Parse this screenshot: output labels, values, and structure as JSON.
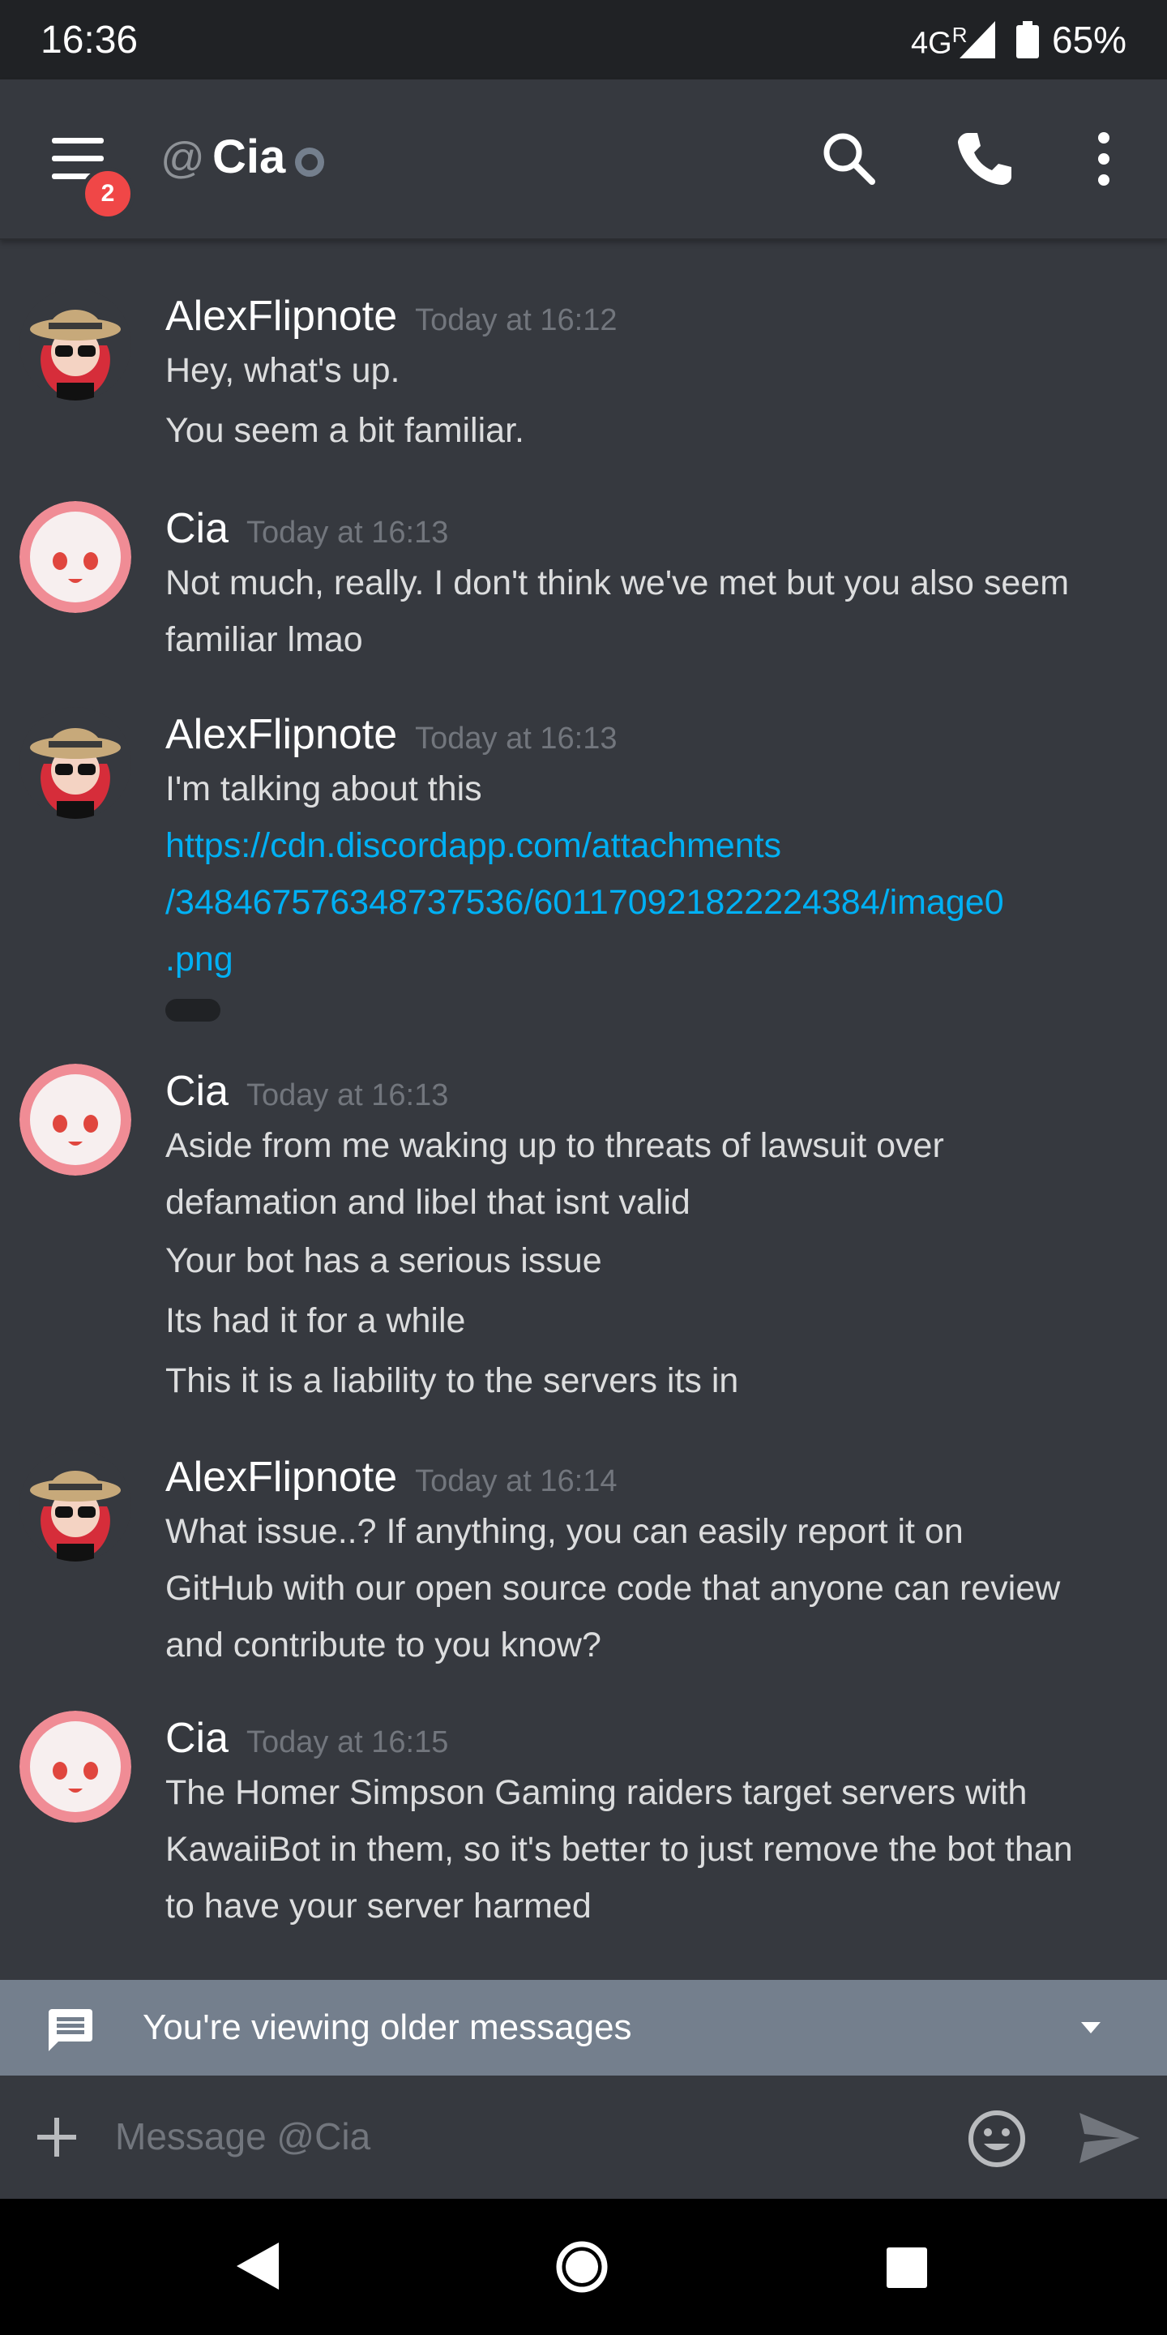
{
  "status_bar": {
    "time": "16:36",
    "network": "4G",
    "roaming": "R",
    "battery": "65%"
  },
  "header": {
    "unread_count": "2",
    "at_symbol": "@",
    "channel": "Cia",
    "status_color": "#747f8d",
    "icons": [
      "menu-icon",
      "search-icon",
      "phone-icon",
      "more-vertical-icon"
    ]
  },
  "messages": [
    {
      "author": "AlexFlipnote",
      "timestamp": "Today at 16:12",
      "lines": [
        "Hey, what's up.",
        "You seem a bit familiar."
      ]
    },
    {
      "author": "Cia",
      "timestamp": "Today at 16:13",
      "lines": [
        "Not much, really. I don't think we've met but you also seem",
        "familiar lmao"
      ]
    },
    {
      "author": "AlexFlipnote",
      "timestamp": "Today at 16:13",
      "lines": [
        "I'm talking about this"
      ],
      "link_lines": [
        "https://cdn.discordapp.com/attachments",
        "/348467576348737536/601170921822224384/image0",
        ".png"
      ]
    },
    {
      "author": "Cia",
      "timestamp": "Today at 16:13",
      "lines": [
        "Aside from me waking up to threats of lawsuit over",
        "defamation and libel that isnt valid",
        "Your bot has a serious issue",
        "Its had it for a while",
        "This it is a liability to the servers its in"
      ]
    },
    {
      "author": "AlexFlipnote",
      "timestamp": "Today at 16:14",
      "lines": [
        "What issue..? If anything, you can easily report it on",
        "GitHub with our open source code that anyone can review",
        "and contribute to you know?"
      ]
    },
    {
      "author": "Cia",
      "timestamp": "Today at 16:15",
      "lines": [
        "The Homer Simpson Gaming raiders target servers with",
        "KawaiiBot in them, so it's better to just remove the bot than",
        "to have your server harmed"
      ]
    }
  ],
  "older_banner": {
    "text": "You're viewing older messages"
  },
  "composer": {
    "placeholder": "Message @Cia"
  },
  "colors": {
    "background": "#36393f",
    "link": "#00b0f4",
    "badge": "#f04747",
    "banner": "#747f8d"
  }
}
